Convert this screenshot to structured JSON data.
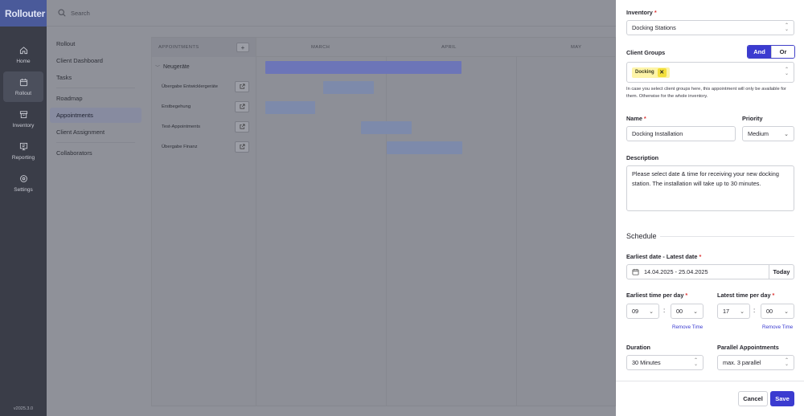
{
  "app": {
    "logo": "Rollouter",
    "version": "v2025.3.0"
  },
  "rail": {
    "items": [
      {
        "label": "Home",
        "icon": "home-icon"
      },
      {
        "label": "Rollout",
        "icon": "calendar-icon"
      },
      {
        "label": "Inventory",
        "icon": "box-icon"
      },
      {
        "label": "Reporting",
        "icon": "report-icon"
      },
      {
        "label": "Settings",
        "icon": "gear-icon"
      }
    ]
  },
  "topbar": {
    "search_placeholder": "Search"
  },
  "subnav": {
    "items": [
      "Rollout",
      "Client Dashboard",
      "Tasks",
      "Roadmap",
      "Appointments",
      "Client Assignment",
      "Collaborators"
    ],
    "active": "Appointments"
  },
  "gantt": {
    "header_title": "APPOINTMENTS",
    "add_label": "+",
    "months": [
      "MARCH",
      "APRIL",
      "MAY"
    ],
    "group": "Neugeräte",
    "rows": [
      "Übergabe Entwicklergeräte",
      "Erstbegehung",
      "Test-Appointments",
      "Übergabe Finanz"
    ]
  },
  "form": {
    "inventory_label": "Inventory",
    "inventory_value": "Docking Stations",
    "client_groups_label": "Client Groups",
    "and_label": "And",
    "or_label": "Or",
    "chip": "Docking",
    "chip_remove": "✕",
    "hint": "In case you select client groups here, this appointment will only be available for them. Otherwise for the whole inventory.",
    "name_label": "Name",
    "name_value": "Docking Installation",
    "priority_label": "Priority",
    "priority_value": "Medium",
    "description_label": "Description",
    "description_value": "Please select date & time for receiving your new docking station. The installation will take up to 30 minutes.",
    "schedule_title": "Schedule",
    "date_range_label": "Earliest date - Latest date",
    "date_range_value": "14.04.2025 - 25.04.2025",
    "today_label": "Today",
    "earliest_time_label": "Earliest time per day",
    "earliest_hour": "09",
    "earliest_min": "00",
    "latest_time_label": "Latest time per day",
    "latest_hour": "17",
    "latest_min": "00",
    "remove_time": "Remove Time",
    "duration_label": "Duration",
    "duration_value": "30 Minutes",
    "parallel_label": "Parallel Appointments",
    "parallel_value": "max. 3 parallel",
    "cancel": "Cancel",
    "save": "Save",
    "required_mark": "*",
    "colon": ":"
  },
  "colors": {
    "accent": "#3b3bd0",
    "chip_bg": "#fdf4a8",
    "required": "#dd3333"
  }
}
